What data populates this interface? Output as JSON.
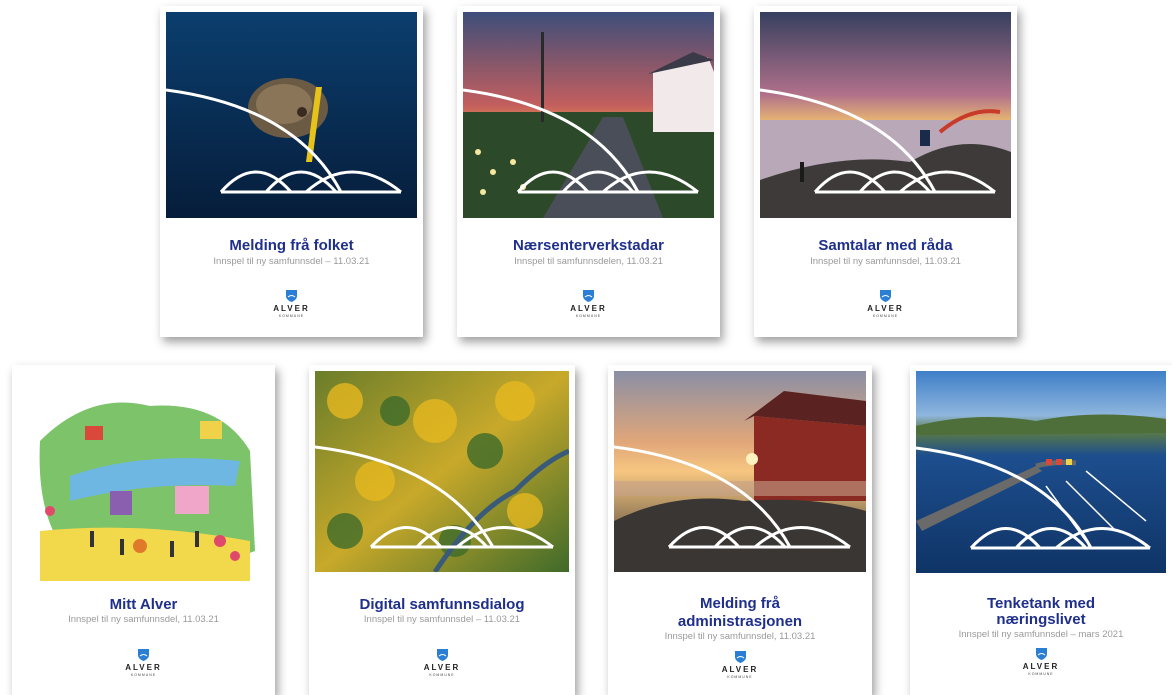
{
  "brand": {
    "name": "ALVER",
    "sub": "KOMMUNE",
    "colors": {
      "title": "#1f2f8c",
      "subtitle": "#9a9a9a",
      "shield": "#2a7fd4"
    }
  },
  "reports": [
    {
      "title": "Melding frå folket",
      "subtitle": "Innspel til ny samfunnsdel – 11.03.21",
      "image": "aerial-kayak-on-rock-in-sea"
    },
    {
      "title": "Nærsenterverkstadar",
      "subtitle": "Innspel til samfunnsdelen, 11.03.21",
      "image": "sunset-road-white-house-daffodils"
    },
    {
      "title": "Samtalar med råda",
      "subtitle": "Innspel til ny samfunnsdel, 11.03.21",
      "image": "sunset-coast-bridge-people-on-rocks"
    },
    {
      "title": "Mitt Alver",
      "subtitle": "Innspel til ny samfunnsdel, 11.03.21",
      "image": "illustrated-community-map"
    },
    {
      "title": "Digital samfunnsdialog",
      "subtitle": "Innspel til ny samfunnsdel – 11.03.21",
      "image": "aerial-autumn-forest"
    },
    {
      "title_line1": "Melding frå",
      "title_line2": "administrasjonen",
      "subtitle": "Innspel til ny samfunnsdel, 11.03.21",
      "image": "red-boathouse-sunset"
    },
    {
      "title_line1": "Tenketank med",
      "title_line2": "næringslivet",
      "subtitle": "Innspel til ny samfunnsdel – mars 2021",
      "image": "bridge-and-marina-aerial"
    }
  ]
}
